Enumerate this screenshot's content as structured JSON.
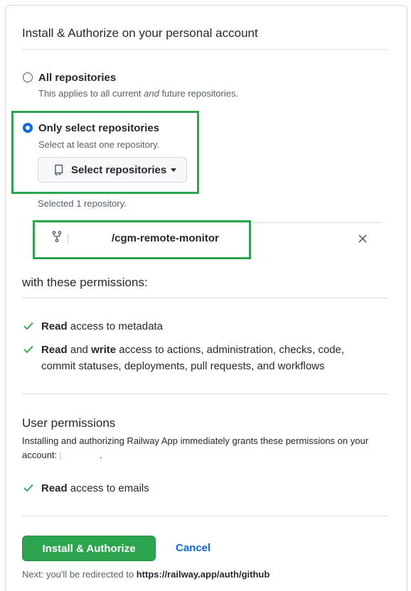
{
  "header": {
    "title": "Install & Authorize on your personal account"
  },
  "repo_access": {
    "all": {
      "label": "All repositories",
      "note_pre": "This applies to all current ",
      "note_em": "and",
      "note_post": " future repositories."
    },
    "select": {
      "label": "Only select repositories",
      "note": "Select at least one repository."
    },
    "select_button": {
      "label": "Select repositories",
      "icon": "repo-icon"
    },
    "selected_count": "Selected 1 repository.",
    "selected_repo": {
      "name": "/cgm-remote-monitor",
      "icon": "repo-forked-icon",
      "remove_icon": "x-icon"
    }
  },
  "permissions": {
    "heading": "with these permissions:",
    "items": [
      {
        "b1": "Read",
        "t1": " access to metadata"
      },
      {
        "b1": "Read",
        "t1": " and ",
        "b2": "write",
        "t2": " access to actions, administration, checks, code,",
        "t3": "commit statuses, deployments, pull requests, and workflows"
      }
    ]
  },
  "user_permissions": {
    "heading": "User permissions",
    "description": "Installing and authorizing Railway App immediately grants these permissions on your",
    "account_label": "account:",
    "account_suffix": ".",
    "items": [
      {
        "b1": "Read",
        "t1": " access to emails"
      }
    ]
  },
  "actions": {
    "install_label": "Install & Authorize",
    "cancel_label": "Cancel"
  },
  "footer": {
    "prefix": "Next: you'll be redirected to ",
    "url": "https://railway.app/auth/github"
  },
  "colors": {
    "accent_blue": "#0969da",
    "primary_green": "#2da44e",
    "highlight_green": "#2da44e"
  }
}
